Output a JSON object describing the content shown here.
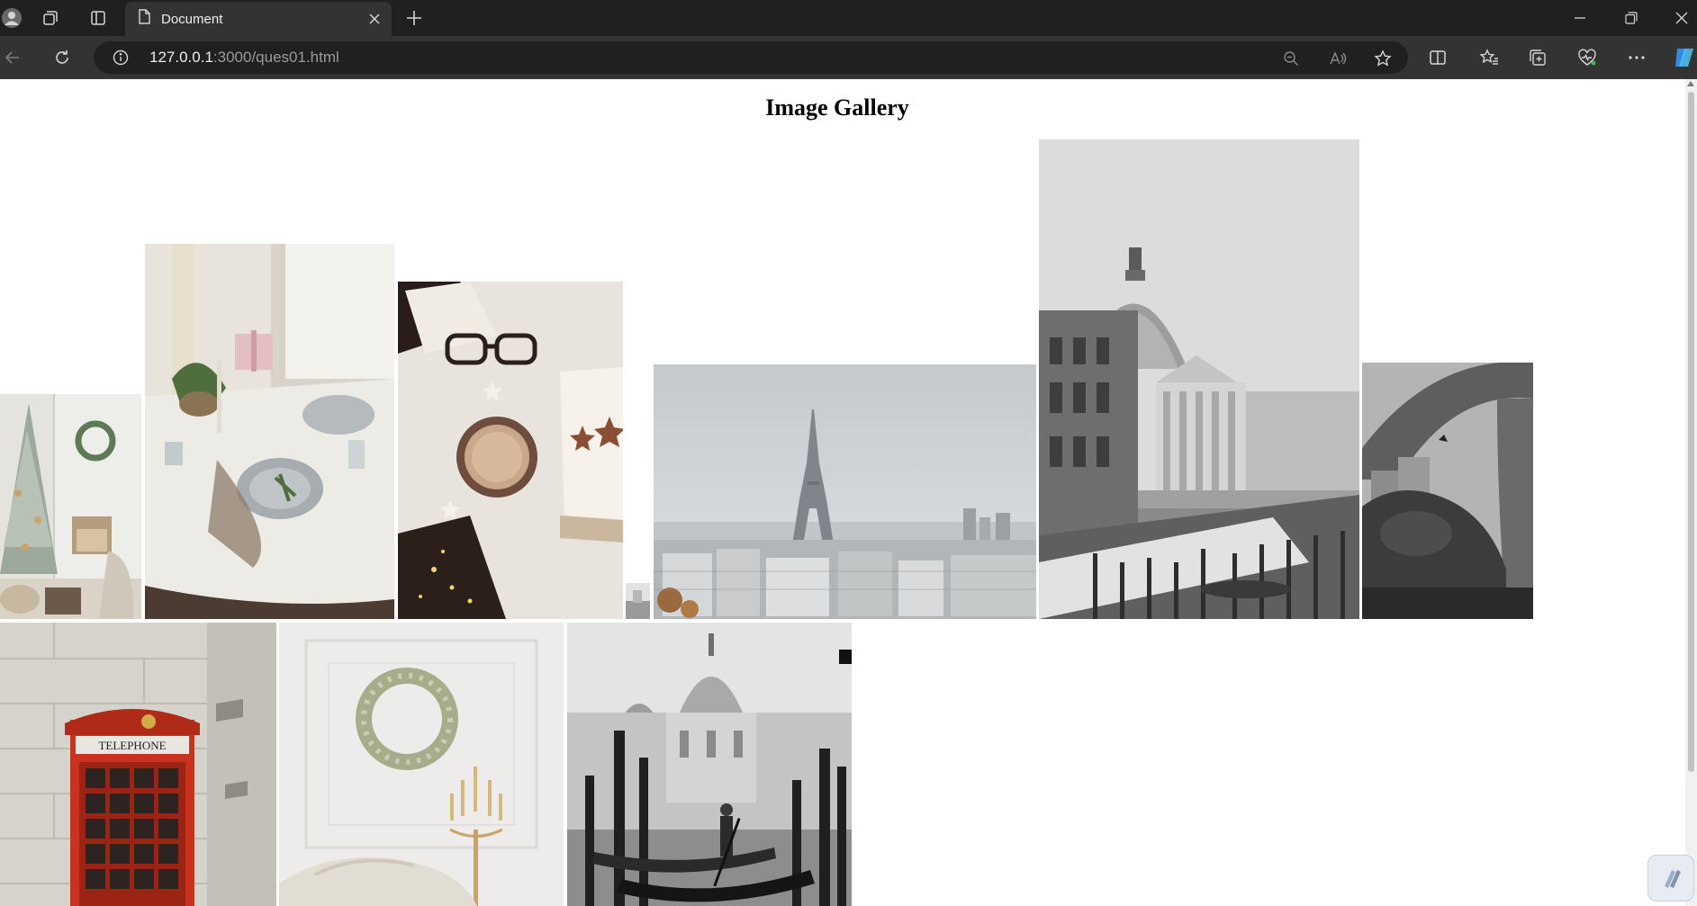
{
  "browser": {
    "tab_title": "Document",
    "url_host": "127.0.0.1",
    "url_rest": ":3000/ques01.html"
  },
  "page": {
    "title": "Image Gallery"
  },
  "gallery": {
    "images": [
      {
        "name": "christmas-tree-room",
        "bg": "#dcdcd6"
      },
      {
        "name": "festive-table-setting",
        "bg": "#d9d2c8"
      },
      {
        "name": "glasses-coffee-cozy",
        "bg": "#e6e1dc"
      },
      {
        "name": "small-thumbnail",
        "bg": "#d6d6d6"
      },
      {
        "name": "paris-eiffel-tower",
        "bg": "#c9ced3"
      },
      {
        "name": "venice-domed-church",
        "bg": "#d8d8d8"
      },
      {
        "name": "stone-arch-bridge",
        "bg": "#6b6b6b"
      },
      {
        "name": "red-telephone-box",
        "bg": "#cfcac4"
      },
      {
        "name": "wreath-white-wall",
        "bg": "#ecebe8"
      },
      {
        "name": "venice-gondolas",
        "bg": "#bdbdbd"
      }
    ],
    "booth_sign": "TELEPHONE"
  },
  "colors": {
    "tabbar": "#202020",
    "toolbar": "#333333",
    "booth_red": "#c8321f"
  }
}
